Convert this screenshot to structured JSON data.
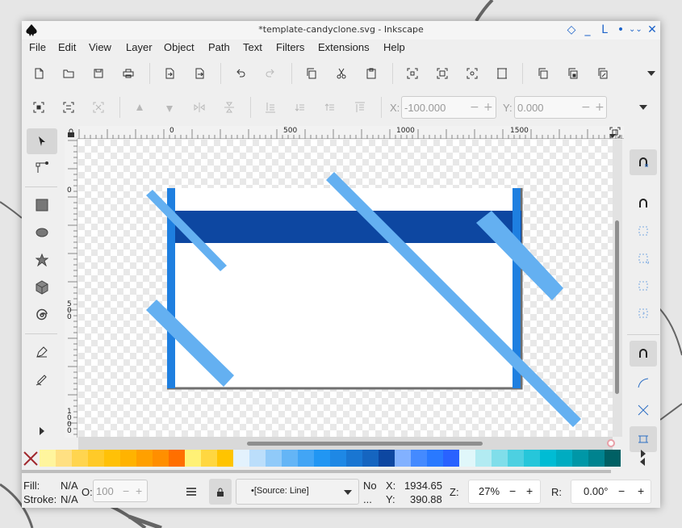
{
  "window": {
    "title": "*template-candyclone.svg - Inkscape",
    "controls": [
      "◇",
      "_",
      "L",
      "•",
      "⌄⌄",
      "✕"
    ]
  },
  "menubar": {
    "items": [
      "File",
      "Edit",
      "View",
      "Layer",
      "Object",
      "Path",
      "Text",
      "Filters",
      "Extensions",
      "Help"
    ]
  },
  "toolbar": {
    "commands": [
      "new-document-icon",
      "open-icon",
      "save-icon",
      "print-icon",
      "import-icon",
      "export-icon",
      "undo-icon",
      "redo-icon",
      "copy-icon",
      "cut-icon",
      "paste-icon",
      "zoom-selection-icon",
      "zoom-drawing-icon",
      "zoom-page-icon",
      "zoom-fit-icon",
      "duplicate-icon",
      "clone-icon",
      "unlink-clone-icon",
      "more-icon"
    ]
  },
  "tool_controls": {
    "x_label": "X:",
    "x_value": "-100.000",
    "y_label": "Y:",
    "y_value": "0.000"
  },
  "ruler": {
    "h_labels": [
      "0",
      "500",
      "1000",
      "1500"
    ],
    "v_labels": [
      "0",
      "5\n0\n0",
      "1\n0\n0\n0"
    ]
  },
  "colors": {
    "banner": "#0d47a1",
    "stripe_light": "#64b0f1",
    "stripe_edge": "#1e7fe0",
    "page_border": "#6f6f6f"
  },
  "palette": {
    "swatches": [
      "#fff59d",
      "#ffe082",
      "#ffd54f",
      "#ffca28",
      "#ffc107",
      "#ffb300",
      "#ffa000",
      "#ff8f00",
      "#ff6f00",
      "#fff176",
      "#ffd740",
      "#ffc400",
      "#e3f2fd",
      "#bbdefb",
      "#90caf9",
      "#64b5f6",
      "#42a5f5",
      "#2196f3",
      "#1e88e5",
      "#1976d2",
      "#1565c0",
      "#0d47a1",
      "#82b1ff",
      "#448aff",
      "#2979ff",
      "#2962ff",
      "#e0f7fa",
      "#b2ebf2",
      "#80deea",
      "#4dd0e1",
      "#26c6da",
      "#00bcd4",
      "#00acc1",
      "#0097a7",
      "#00838f",
      "#006064"
    ]
  },
  "status": {
    "fill_label": "Fill:",
    "fill_value": "N/A",
    "stroke_label": "Stroke:",
    "stroke_value": "N/A",
    "opacity_label": "O:",
    "opacity_value": "100",
    "layer_dropdown": "•[Source: Line]",
    "no_label": "No",
    "ellipsis": "...",
    "x_label": "X:",
    "x_value": "1934.65",
    "y_label": "Y:",
    "y_value": "390.88",
    "zoom_label": "Z:",
    "zoom_value": "27%",
    "rotate_label": "R:",
    "rotate_value": "0.00°"
  }
}
